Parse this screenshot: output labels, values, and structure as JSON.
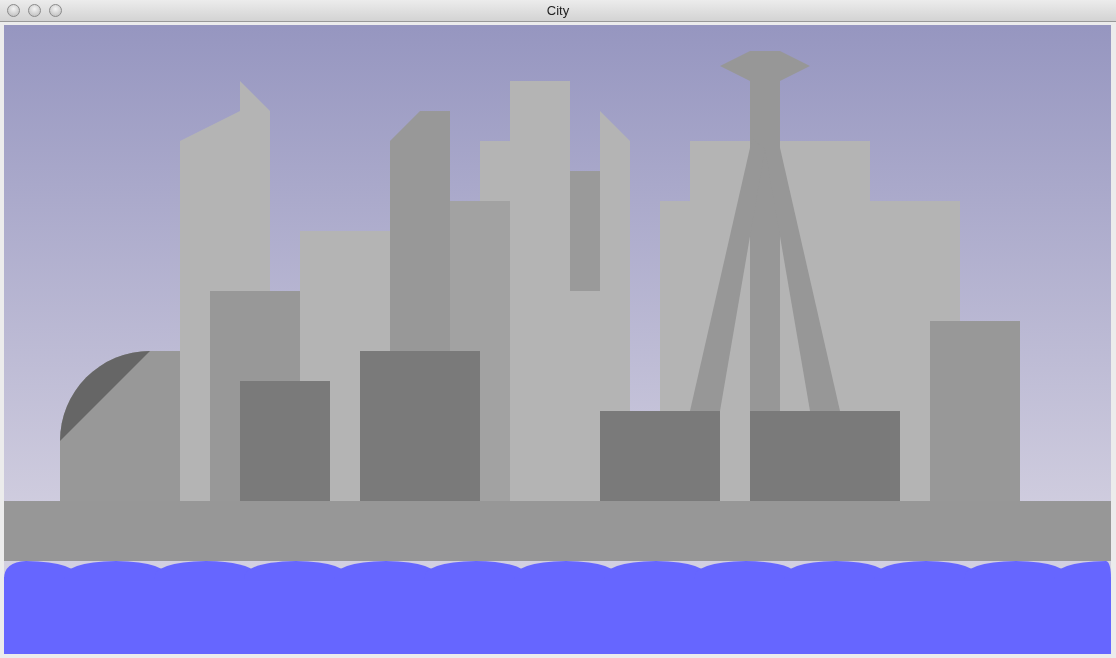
{
  "window": {
    "title": "City"
  }
}
